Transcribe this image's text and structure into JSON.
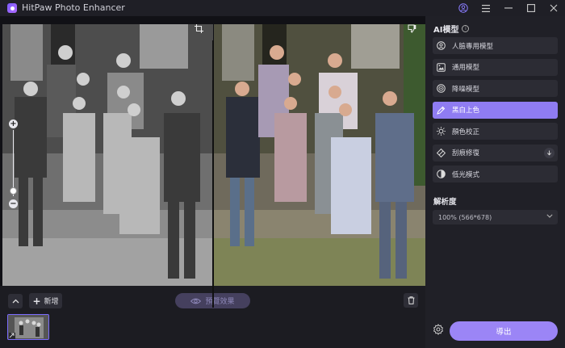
{
  "window": {
    "title": "HitPaw Photo Enhancer",
    "controls": [
      "user-icon",
      "menu-icon",
      "minimize-icon",
      "maximize-icon",
      "close-icon"
    ]
  },
  "panel": {
    "section_title": "AI模型",
    "models": [
      {
        "label": "人臉專用模型",
        "icon": "face-icon",
        "active": false
      },
      {
        "label": "通用模型",
        "icon": "image-icon",
        "active": false
      },
      {
        "label": "降噪模型",
        "icon": "denoise-icon",
        "active": false
      },
      {
        "label": "黑白上色",
        "icon": "colorize-icon",
        "active": true
      },
      {
        "label": "顏色校正",
        "icon": "brightness-icon",
        "active": false
      },
      {
        "label": "刮痕修復",
        "icon": "scratch-repair-icon",
        "active": false,
        "download": true
      },
      {
        "label": "低光模式",
        "icon": "lowlight-icon",
        "active": false
      }
    ],
    "resolution_label": "解析度",
    "resolution_value": "100% (566*678)",
    "export_label": "導出"
  },
  "bottom": {
    "add_label": "新增",
    "preview_label": "預覽效果"
  },
  "colors": {
    "accent": "#8f7cf2",
    "export": "#9b85f6",
    "panel_bg": "#202027",
    "item_bg": "#2c2c34"
  }
}
